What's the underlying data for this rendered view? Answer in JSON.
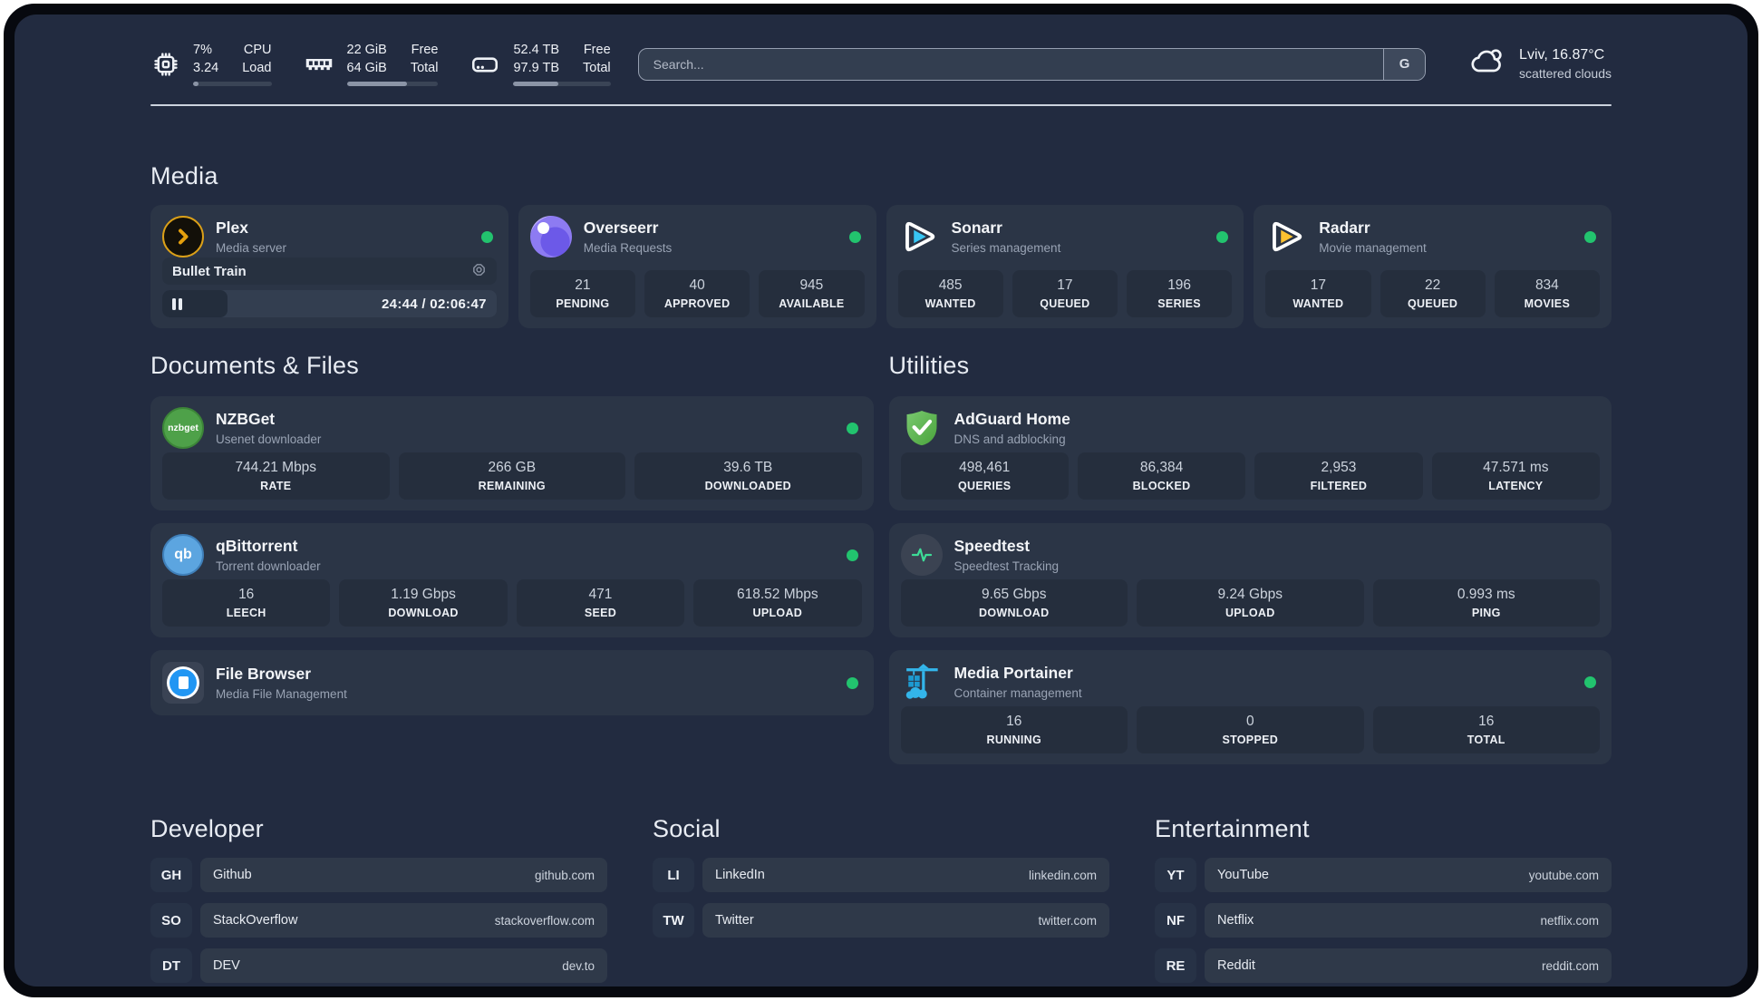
{
  "colors": {
    "page_background": "#222b40",
    "card_background": "#2b3546",
    "tile_background": "#252e3d",
    "status_online": "#22c36e",
    "plex_orange": "#e5a00d",
    "sonarr_blue": "#38c6f4",
    "radarr_gold": "#ffc230",
    "nzbget_green": "#4ea149",
    "qbittorrent_blue": "#5ca5e0",
    "adguard_green": "#5cb85c",
    "speedtest_pulse": "#3ddc97",
    "portainer_blue": "#29abe2"
  },
  "header": {
    "system_stats": [
      {
        "icon": "cpu-icon",
        "values": [
          "7%",
          "3.24"
        ],
        "labels": [
          "CPU",
          "Load"
        ],
        "progress_pct": 7
      },
      {
        "icon": "ram-icon",
        "values": [
          "22 GiB",
          "64 GiB"
        ],
        "labels": [
          "Free",
          "Total"
        ],
        "progress_pct": 66
      },
      {
        "icon": "disk-icon",
        "values": [
          "52.4 TB",
          "97.9 TB"
        ],
        "labels": [
          "Free",
          "Total"
        ],
        "progress_pct": 46
      }
    ],
    "search": {
      "placeholder": "Search...",
      "engine_button": "G"
    },
    "weather": {
      "title": "Lviv, 16.87°C",
      "condition": "scattered clouds"
    }
  },
  "media_section": {
    "title": "Media",
    "plex": {
      "title": "Plex",
      "subtitle": "Media server",
      "status": "online",
      "now_playing": {
        "name": "Bullet Train",
        "time_display": "24:44 / 02:06:47",
        "progress_pct": 19.5
      }
    },
    "overseerr": {
      "title": "Overseerr",
      "subtitle": "Media Requests",
      "status": "online",
      "stats": [
        {
          "value": "21",
          "label": "PENDING"
        },
        {
          "value": "40",
          "label": "APPROVED"
        },
        {
          "value": "945",
          "label": "AVAILABLE"
        }
      ]
    },
    "sonarr": {
      "title": "Sonarr",
      "subtitle": "Series management",
      "status": "online",
      "stats": [
        {
          "value": "485",
          "label": "WANTED"
        },
        {
          "value": "17",
          "label": "QUEUED"
        },
        {
          "value": "196",
          "label": "SERIES"
        }
      ]
    },
    "radarr": {
      "title": "Radarr",
      "subtitle": "Movie management",
      "status": "online",
      "stats": [
        {
          "value": "17",
          "label": "WANTED"
        },
        {
          "value": "22",
          "label": "QUEUED"
        },
        {
          "value": "834",
          "label": "MOVIES"
        }
      ]
    }
  },
  "documents_section": {
    "title": "Documents & Files",
    "nzbget": {
      "title": "NZBGet",
      "subtitle": "Usenet downloader",
      "status": "online",
      "icon_text": "nzbget",
      "stats": [
        {
          "value": "744.21 Mbps",
          "label": "RATE"
        },
        {
          "value": "266 GB",
          "label": "REMAINING"
        },
        {
          "value": "39.6 TB",
          "label": "DOWNLOADED"
        }
      ]
    },
    "qbittorrent": {
      "title": "qBittorrent",
      "subtitle": "Torrent downloader",
      "status": "online",
      "icon_text": "qb",
      "stats": [
        {
          "value": "16",
          "label": "LEECH"
        },
        {
          "value": "1.19 Gbps",
          "label": "DOWNLOAD"
        },
        {
          "value": "471",
          "label": "SEED"
        },
        {
          "value": "618.52 Mbps",
          "label": "UPLOAD"
        }
      ]
    },
    "filebrowser": {
      "title": "File Browser",
      "subtitle": "Media File Management",
      "status": "online"
    }
  },
  "utilities_section": {
    "title": "Utilities",
    "adguard": {
      "title": "AdGuard Home",
      "subtitle": "DNS and adblocking",
      "stats": [
        {
          "value": "498,461",
          "label": "QUERIES"
        },
        {
          "value": "86,384",
          "label": "BLOCKED"
        },
        {
          "value": "2,953",
          "label": "FILTERED"
        },
        {
          "value": "47.571 ms",
          "label": "LATENCY"
        }
      ]
    },
    "speedtest": {
      "title": "Speedtest",
      "subtitle": "Speedtest Tracking",
      "stats": [
        {
          "value": "9.65 Gbps",
          "label": "DOWNLOAD"
        },
        {
          "value": "9.24 Gbps",
          "label": "UPLOAD"
        },
        {
          "value": "0.993 ms",
          "label": "PING"
        }
      ]
    },
    "portainer": {
      "title": "Media Portainer",
      "subtitle": "Container management",
      "status": "online",
      "stats": [
        {
          "value": "16",
          "label": "RUNNING"
        },
        {
          "value": "0",
          "label": "STOPPED"
        },
        {
          "value": "16",
          "label": "TOTAL"
        }
      ]
    }
  },
  "bookmarks": [
    {
      "title": "Developer",
      "items": [
        {
          "abbr": "GH",
          "name": "Github",
          "url": "github.com"
        },
        {
          "abbr": "SO",
          "name": "StackOverflow",
          "url": "stackoverflow.com"
        },
        {
          "abbr": "DT",
          "name": "DEV",
          "url": "dev.to"
        }
      ]
    },
    {
      "title": "Social",
      "items": [
        {
          "abbr": "LI",
          "name": "LinkedIn",
          "url": "linkedin.com"
        },
        {
          "abbr": "TW",
          "name": "Twitter",
          "url": "twitter.com"
        }
      ]
    },
    {
      "title": "Entertainment",
      "items": [
        {
          "abbr": "YT",
          "name": "YouTube",
          "url": "youtube.com"
        },
        {
          "abbr": "NF",
          "name": "Netflix",
          "url": "netflix.com"
        },
        {
          "abbr": "RE",
          "name": "Reddit",
          "url": "reddit.com"
        }
      ]
    }
  ]
}
